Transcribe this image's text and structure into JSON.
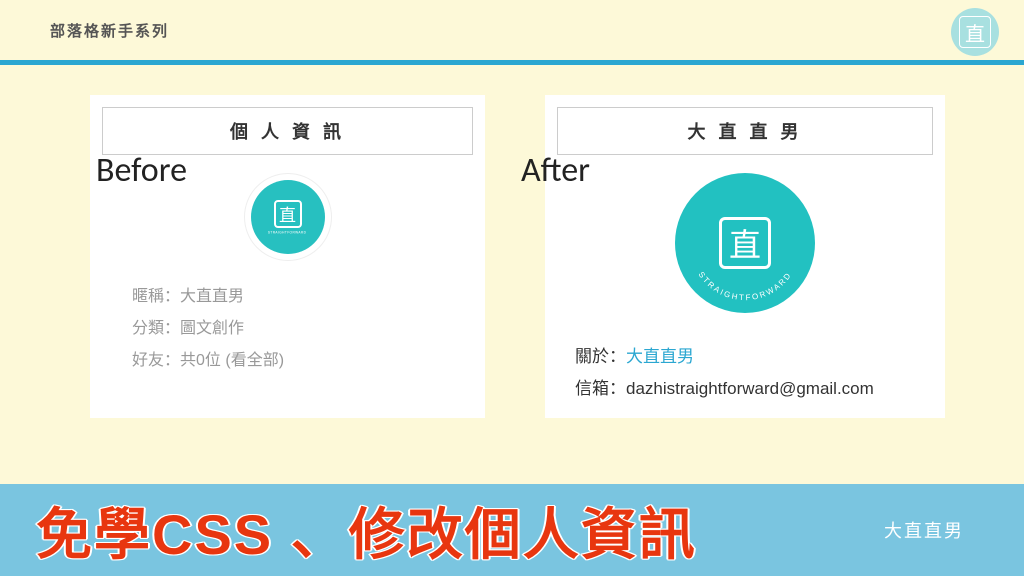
{
  "header": {
    "series_title": "部落格新手系列",
    "logo_char": "直"
  },
  "before": {
    "overlay_label": "Before",
    "panel_title": "個 人 資 訊",
    "logo_char": "直",
    "logo_sub": "STRAIGHTFORWARD",
    "nickname_label": "暱稱：",
    "nickname_value": "大直直男",
    "category_label": "分類：",
    "category_value": "圖文創作",
    "friends_label": "好友：",
    "friends_value": "共0位 (看全部)"
  },
  "after": {
    "overlay_label": "After",
    "panel_title": "大 直 直 男",
    "logo_char": "直",
    "logo_sub": "STRAIGHTFORWARD",
    "about_label": "關於：",
    "about_value": "大直直男",
    "email_label": "信箱：",
    "email_value": "dazhistraightforward@gmail.com"
  },
  "footer": {
    "headline": "免學CSS 、修改個人資訊",
    "author": "大直直男"
  }
}
